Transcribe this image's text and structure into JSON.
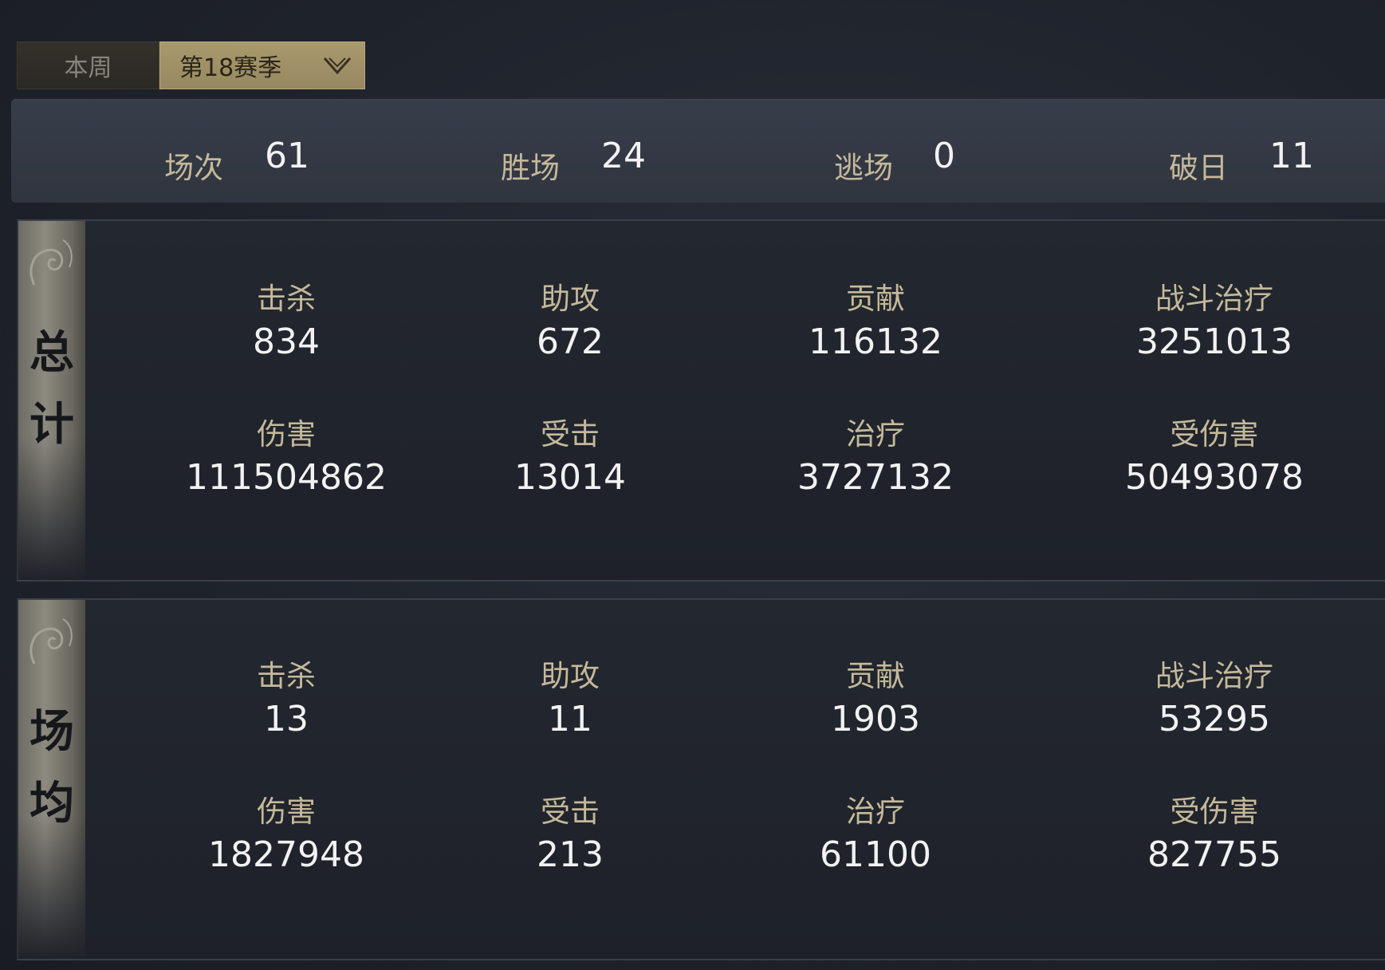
{
  "tabs": {
    "week_label": "本周",
    "season_label": "第18赛季"
  },
  "summary": {
    "matches_label": "场次",
    "matches_value": "61",
    "wins_label": "胜场",
    "wins_value": "24",
    "escapes_label": "逃场",
    "escapes_value": "0",
    "breaks_label": "破日",
    "breaks_value": "11"
  },
  "total": {
    "side_char_1": "总",
    "side_char_2": "计",
    "kills_label": "击杀",
    "kills_value": "834",
    "assists_label": "助攻",
    "assists_value": "672",
    "contribution_label": "贡献",
    "contribution_value": "116132",
    "battle_heal_label": "战斗治疗",
    "battle_heal_value": "3251013",
    "damage_label": "伤害",
    "damage_value": "111504862",
    "hits_taken_label": "受击",
    "hits_taken_value": "13014",
    "heal_label": "治疗",
    "heal_value": "3727132",
    "damage_taken_label": "受伤害",
    "damage_taken_value": "50493078"
  },
  "average": {
    "side_char_1": "场",
    "side_char_2": "均",
    "kills_label": "击杀",
    "kills_value": "13",
    "assists_label": "助攻",
    "assists_value": "11",
    "contribution_label": "贡献",
    "contribution_value": "1903",
    "battle_heal_label": "战斗治疗",
    "battle_heal_value": "53295",
    "damage_label": "伤害",
    "damage_value": "1827948",
    "hits_taken_label": "受击",
    "hits_taken_value": "213",
    "heal_label": "治疗",
    "heal_value": "61100",
    "damage_taken_label": "受伤害",
    "damage_taken_value": "827755"
  },
  "colors": {
    "label": "#c5b99a",
    "value": "#f2f2f2",
    "active_tab": "#a9996d"
  },
  "icons": {
    "dropdown": "chevron-down-icon",
    "ornament": "cloud-scroll-ornament"
  }
}
